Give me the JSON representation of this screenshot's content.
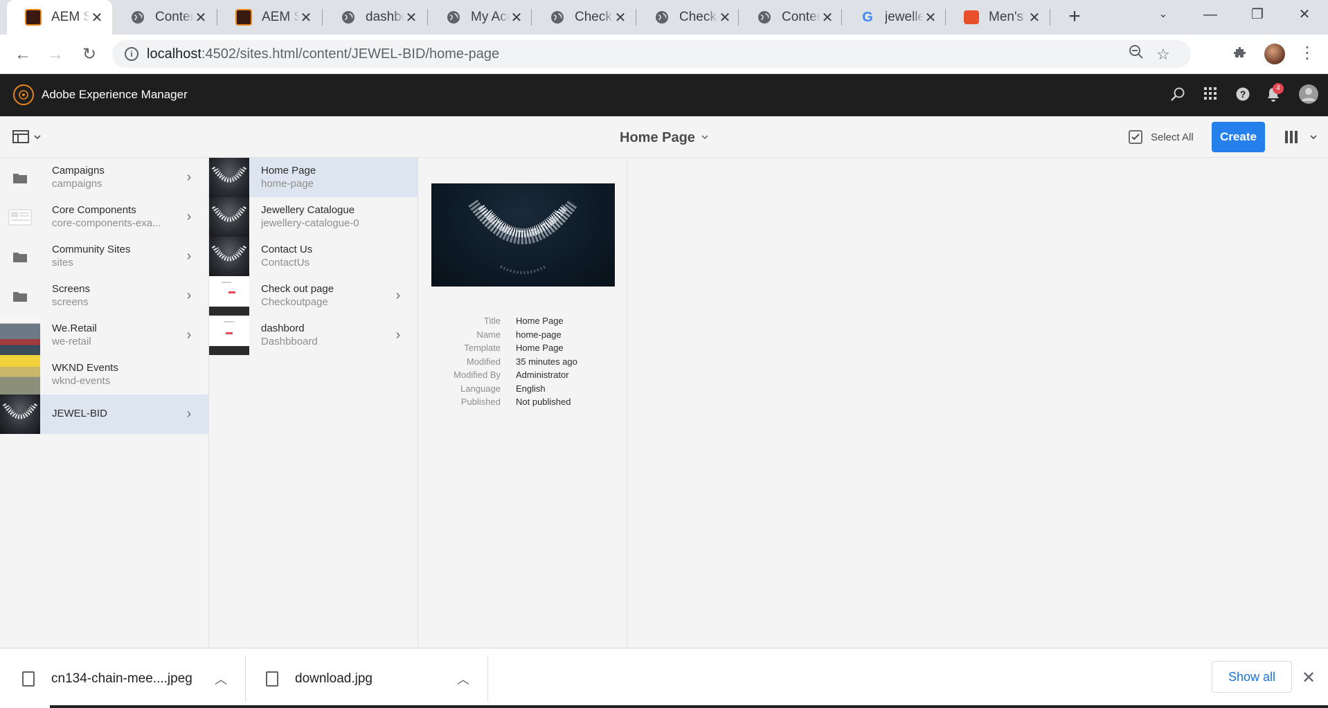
{
  "browser": {
    "tabs": [
      {
        "title": "AEM Sites",
        "icon": "aem-icon",
        "active": true
      },
      {
        "title": "Content",
        "icon": "globe-icon"
      },
      {
        "title": "AEM Sites",
        "icon": "aem-icon"
      },
      {
        "title": "dashbord",
        "icon": "globe-icon"
      },
      {
        "title": "My Account",
        "icon": "globe-icon"
      },
      {
        "title": "Check out",
        "icon": "globe-icon"
      },
      {
        "title": "Checkout",
        "icon": "globe-icon"
      },
      {
        "title": "Content",
        "icon": "globe-icon"
      },
      {
        "title": "jewellery",
        "icon": "google-icon"
      },
      {
        "title": "Men's",
        "icon": "shopping-bag-icon"
      }
    ],
    "url_host": "localhost",
    "url_path": ":4502/sites.html/content/JEWEL-BID/home-page"
  },
  "aem": {
    "app_title": "Adobe Experience Manager",
    "notification_count": "4"
  },
  "actionbar": {
    "title": "Home Page",
    "select_all_label": "Select All",
    "create_label": "Create"
  },
  "column1": [
    {
      "title": "Campaigns",
      "name": "campaigns",
      "thumb": "folder",
      "has_children": true
    },
    {
      "title": "Core Components",
      "name": "core-components-exa...",
      "thumb": "page",
      "has_children": true
    },
    {
      "title": "Community Sites",
      "name": "sites",
      "thumb": "folder",
      "has_children": true
    },
    {
      "title": "Screens",
      "name": "screens",
      "thumb": "folder",
      "has_children": true
    },
    {
      "title": "We.Retail",
      "name": "we-retail",
      "thumb": "retail",
      "has_children": true
    },
    {
      "title": "WKND Events",
      "name": "wknd-events",
      "thumb": "wknd",
      "has_children": false
    },
    {
      "title": "JEWEL-BID",
      "name": "",
      "thumb": "necklace",
      "has_children": true,
      "selected": true
    }
  ],
  "column2": [
    {
      "title": "Home Page",
      "name": "home-page",
      "thumb": "necklace",
      "has_children": false,
      "selected": true
    },
    {
      "title": "Jewellery Catalogue",
      "name": "jewellery-catalogue-0",
      "thumb": "necklace",
      "has_children": false
    },
    {
      "title": "Contact Us",
      "name": "ContactUs",
      "thumb": "necklace",
      "has_children": false
    },
    {
      "title": "Check out page",
      "name": "Checkoutpage",
      "thumb": "web",
      "has_children": true
    },
    {
      "title": "dashbord",
      "name": "Dashbboard",
      "thumb": "web",
      "has_children": true
    }
  ],
  "preview": {
    "meta": [
      {
        "key": "Title",
        "value": "Home Page"
      },
      {
        "key": "Name",
        "value": "home-page"
      },
      {
        "key": "Template",
        "value": "Home Page"
      },
      {
        "key": "Modified",
        "value": "35 minutes ago"
      },
      {
        "key": "Modified By",
        "value": "Administrator"
      },
      {
        "key": "Language",
        "value": "English"
      },
      {
        "key": "Published",
        "value": "Not published"
      }
    ]
  },
  "downloads": {
    "items": [
      {
        "filename": "cn134-chain-mee....jpeg"
      },
      {
        "filename": "download.jpg"
      }
    ],
    "show_all_label": "Show all"
  },
  "colors": {
    "accent": "#2680eb",
    "aem_header": "#1e1e1e",
    "selected_row": "#dde6f0",
    "aem_logo": "#e68619",
    "badge": "#e34850"
  }
}
